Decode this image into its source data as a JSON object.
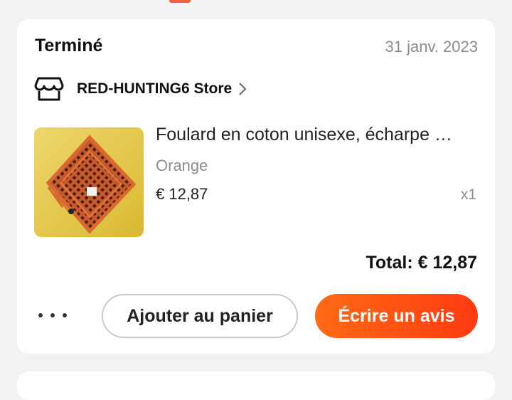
{
  "order": {
    "status": "Terminé",
    "date": "31 janv. 2023",
    "store": {
      "name": "RED-HUNTING6 Store",
      "icon": "store-icon"
    },
    "item": {
      "title": "Foulard en coton unisexe, écharpe …",
      "variant": "Orange",
      "price": "€ 12,87",
      "quantity": "x1"
    },
    "total": "Total: € 12,87"
  },
  "actions": {
    "more_icon": "more-dots-icon",
    "add_to_cart": "Ajouter au panier",
    "write_review": "Écrire un avis"
  },
  "colors": {
    "accent_start": "#ff6a14",
    "accent_end": "#ff3b12",
    "background": "#f2f2f2",
    "card": "#ffffff"
  }
}
